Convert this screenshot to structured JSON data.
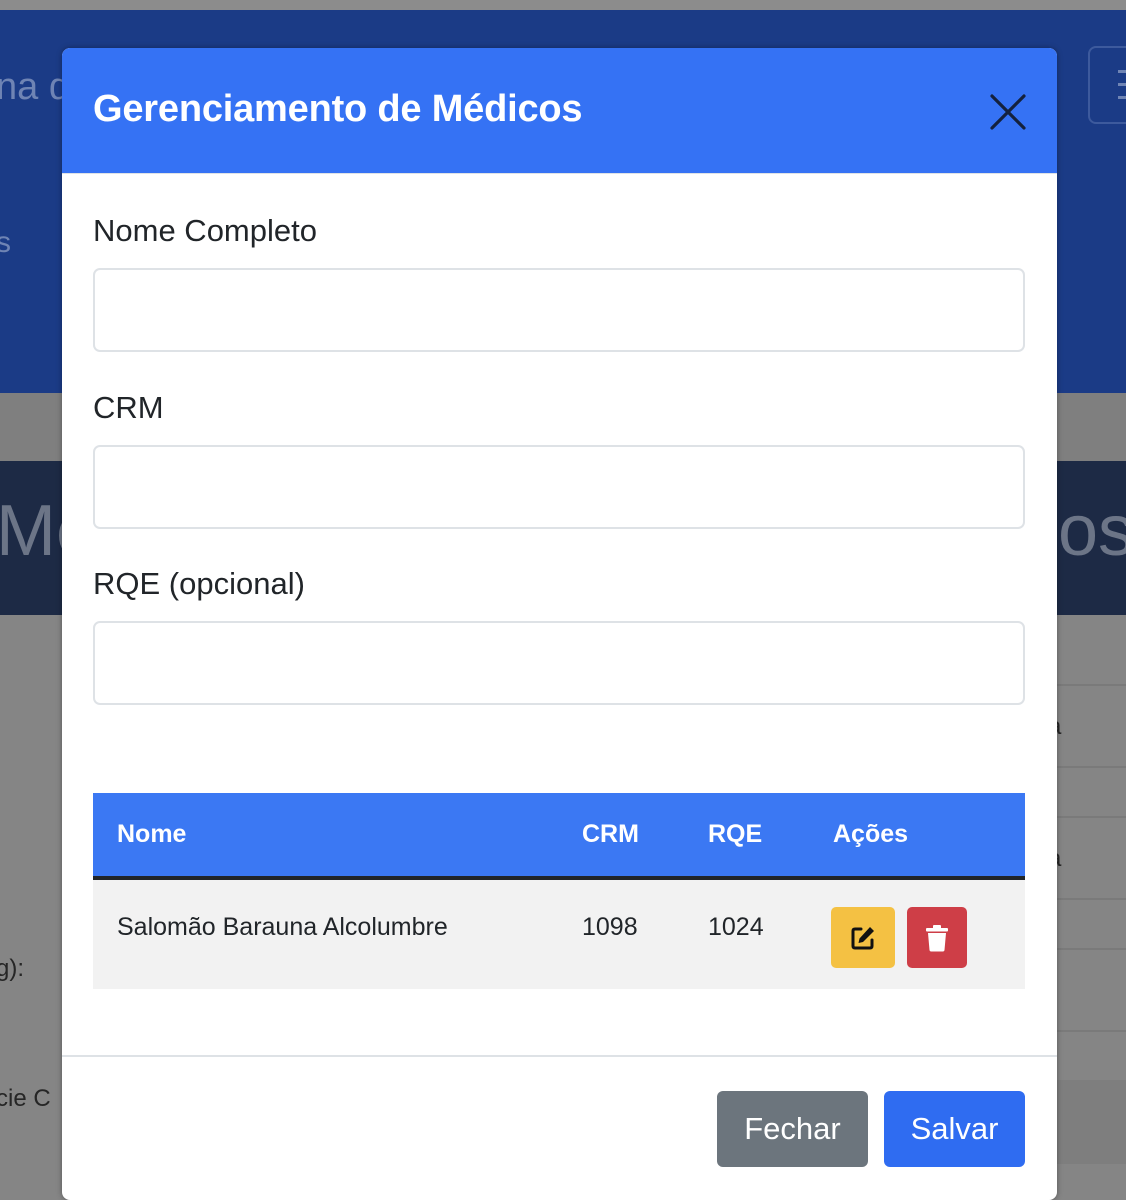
{
  "background": {
    "navbar_fragment_1": "na d",
    "navbar_fragment_2": "s",
    "hero_fragment_left": "Me",
    "hero_fragment_right": "os",
    "row_fragment_1": "a",
    "row_fragment_2": "a",
    "label_fragment_1": "g):",
    "label_fragment_2": "cie C"
  },
  "modal": {
    "title": "Gerenciamento de Médicos",
    "close_icon": "close-x-icon",
    "fields": {
      "nome": {
        "label": "Nome Completo",
        "value": "",
        "placeholder": ""
      },
      "crm": {
        "label": "CRM",
        "value": "",
        "placeholder": ""
      },
      "rqe": {
        "label": "RQE (opcional)",
        "value": "",
        "placeholder": ""
      }
    },
    "table": {
      "headers": {
        "nome": "Nome",
        "crm": "CRM",
        "rqe": "RQE",
        "acoes": "Ações"
      },
      "rows": [
        {
          "nome": "Salomão Barauna Alcolumbre",
          "crm": "1098",
          "rqe": "1024",
          "edit_icon": "edit-icon",
          "delete_icon": "trash-icon"
        }
      ]
    },
    "footer": {
      "close_label": "Fechar",
      "save_label": "Salvar"
    }
  },
  "colors": {
    "header": "#3572f4",
    "table_header": "#3b78f3",
    "edit_button": "#f4c143",
    "delete_button": "#ce3e47",
    "close_button": "#6c757d",
    "save_button": "#2f6cf1"
  }
}
